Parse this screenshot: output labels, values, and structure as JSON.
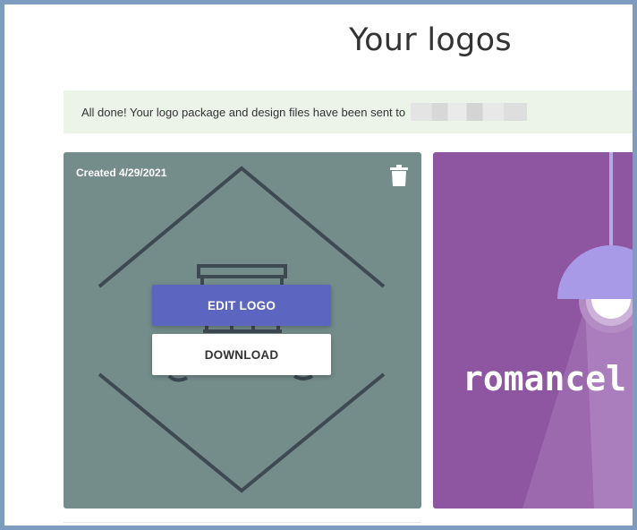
{
  "page": {
    "title": "Your logos"
  },
  "notice": {
    "text": "All done! Your logo package and design files have been sent to"
  },
  "cards": [
    {
      "created_label": "Created 4/29/2021",
      "edit_label": "EDIT LOGO",
      "download_label": "DOWNLOAD",
      "background_color": "#748d8b",
      "delete_icon": "trash-icon"
    },
    {
      "brand_text": "romancel",
      "background_color": "#8e55a0",
      "icon": "pendant-lamp-icon"
    }
  ],
  "colors": {
    "edit_button": "#5c65c0",
    "notice_background": "#ecf4ea",
    "frame_border": "#7d9cc0"
  }
}
